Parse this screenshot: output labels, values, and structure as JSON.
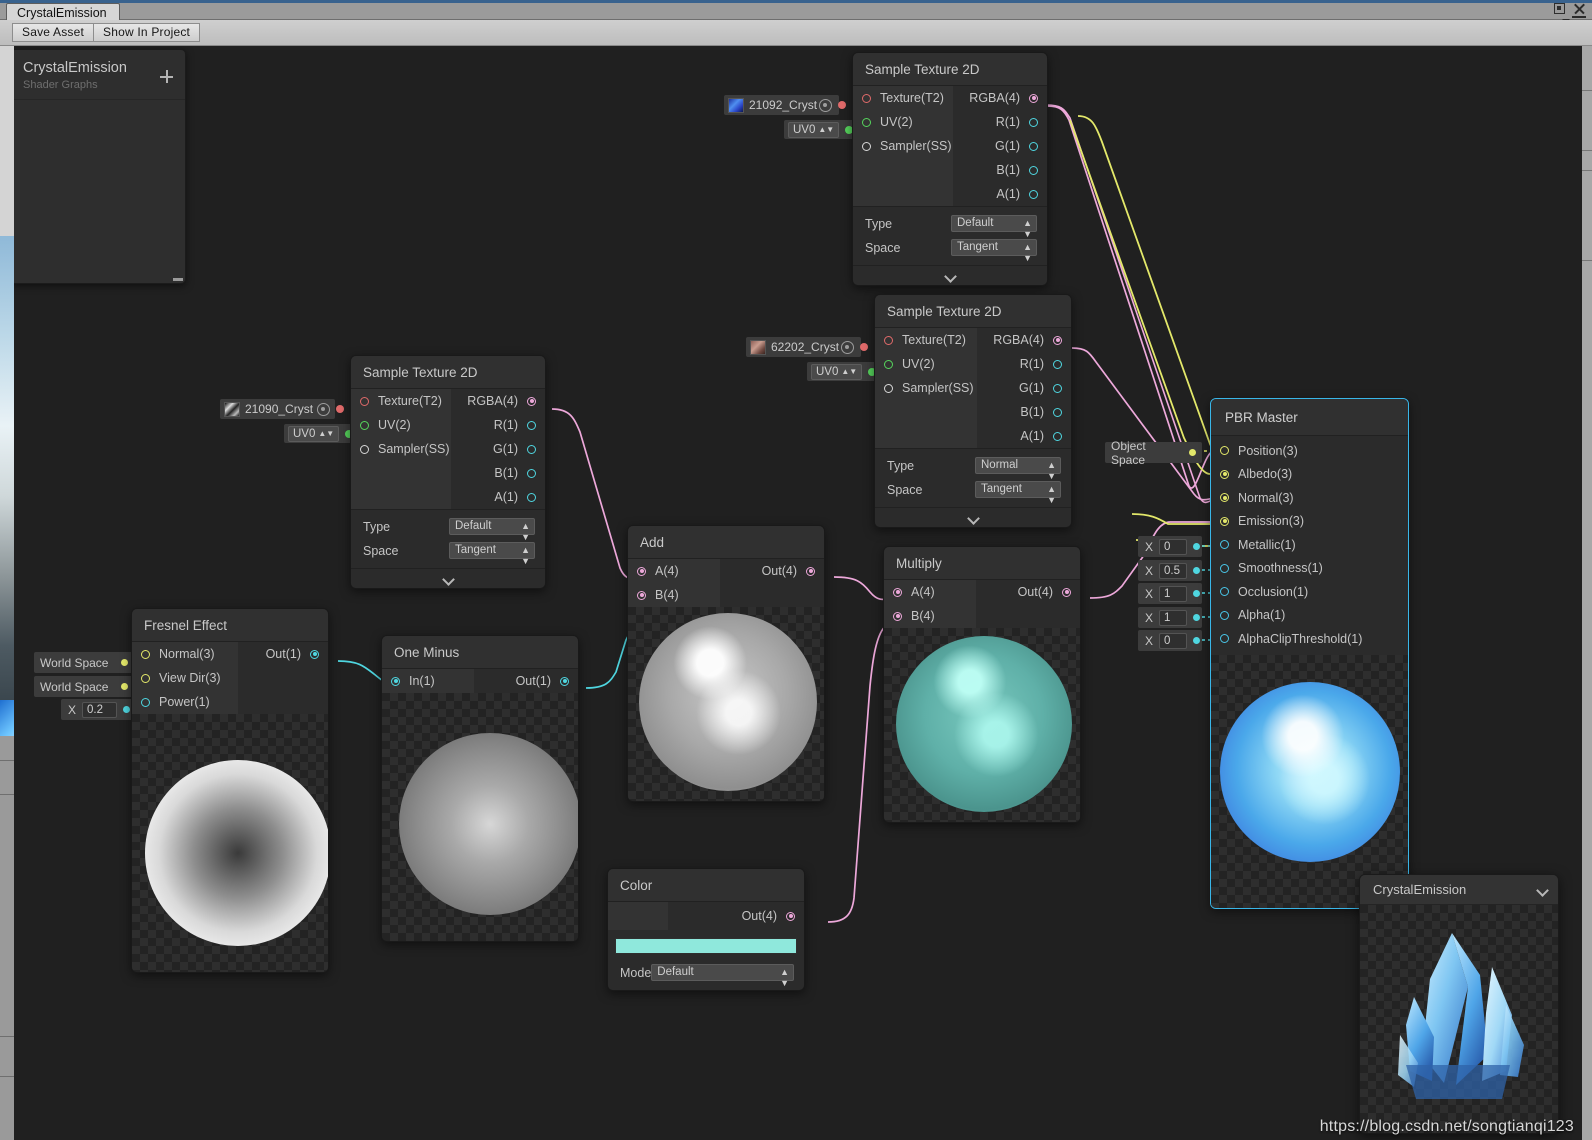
{
  "window": {
    "tab_label": "CrystalEmission",
    "maximize_icon": "maximize-icon",
    "close_icon": "close-icon",
    "menu_icon": "hamburger-menu-icon"
  },
  "toolbar": {
    "save_asset": "Save Asset",
    "show_in_project": "Show In Project"
  },
  "blackboard": {
    "title": "CrystalEmission",
    "subtitle": "Shader Graphs",
    "add_icon": "plus-icon"
  },
  "nodes": {
    "sample_texture_top": {
      "title": "Sample Texture 2D",
      "inputs": [
        "Texture(T2)",
        "UV(2)",
        "Sampler(SS)"
      ],
      "outputs": [
        "RGBA(4)",
        "R(1)",
        "G(1)",
        "B(1)",
        "A(1)"
      ],
      "fields": [
        {
          "label": "Type",
          "value": "Default"
        },
        {
          "label": "Space",
          "value": "Tangent"
        }
      ]
    },
    "sample_texture_mid": {
      "title": "Sample Texture 2D",
      "inputs": [
        "Texture(T2)",
        "UV(2)",
        "Sampler(SS)"
      ],
      "outputs": [
        "RGBA(4)",
        "R(1)",
        "G(1)",
        "B(1)",
        "A(1)"
      ],
      "fields": [
        {
          "label": "Type",
          "value": "Normal"
        },
        {
          "label": "Space",
          "value": "Tangent"
        }
      ]
    },
    "sample_texture_left": {
      "title": "Sample Texture 2D",
      "inputs": [
        "Texture(T2)",
        "UV(2)",
        "Sampler(SS)"
      ],
      "outputs": [
        "RGBA(4)",
        "R(1)",
        "G(1)",
        "B(1)",
        "A(1)"
      ],
      "fields": [
        {
          "label": "Type",
          "value": "Default"
        },
        {
          "label": "Space",
          "value": "Tangent"
        }
      ]
    },
    "fresnel": {
      "title": "Fresnel Effect",
      "inputs": [
        "Normal(3)",
        "View Dir(3)",
        "Power(1)"
      ],
      "outputs": [
        "Out(1)"
      ]
    },
    "one_minus": {
      "title": "One Minus",
      "inputs": [
        "In(1)"
      ],
      "outputs": [
        "Out(1)"
      ]
    },
    "add": {
      "title": "Add",
      "inputs": [
        "A(4)",
        "B(4)"
      ],
      "outputs": [
        "Out(4)"
      ]
    },
    "multiply": {
      "title": "Multiply",
      "inputs": [
        "A(4)",
        "B(4)"
      ],
      "outputs": [
        "Out(4)"
      ]
    },
    "color": {
      "title": "Color",
      "outputs": [
        "Out(4)"
      ],
      "swatch_hex": "#8fe8dc",
      "mode_label": "Mode",
      "mode_value": "Default"
    },
    "pbr_master": {
      "title": "PBR Master",
      "inputs": [
        "Position(3)",
        "Albedo(3)",
        "Normal(3)",
        "Emission(3)",
        "Metallic(1)",
        "Smoothness(1)",
        "Occlusion(1)",
        "Alpha(1)",
        "AlphaClipThreshold(1)"
      ]
    }
  },
  "chips": {
    "texture_top": {
      "name": "21092_Cryst",
      "target_icon": "target-icon"
    },
    "texture_mid": {
      "name": "62202_Cryst",
      "target_icon": "target-icon"
    },
    "texture_left": {
      "name": "21090_Cryst",
      "target_icon": "target-icon"
    },
    "uv_top": "UV0",
    "uv_mid": "UV0",
    "uv_left": "UV0",
    "fresnel_normal_space": "World Space",
    "fresnel_viewdir_space": "World Space",
    "fresnel_power": {
      "axis": "X",
      "value": "0.2"
    },
    "master_position_space": "Object Space",
    "master_metallic": {
      "axis": "X",
      "value": "0"
    },
    "master_smoothness": {
      "axis": "X",
      "value": "0.5"
    },
    "master_occlusion": {
      "axis": "X",
      "value": "1"
    },
    "master_alpha": {
      "axis": "X",
      "value": "1"
    },
    "master_alphaclip": {
      "axis": "X",
      "value": "0"
    }
  },
  "main_preview": {
    "title": "CrystalEmission",
    "collapse_icon": "chevron-down-icon"
  },
  "watermark": "https://blog.csdn.net/songtianqi123",
  "colors": {
    "accent_master_border": "#39b6e8",
    "wire_vec4": "#eda8da",
    "wire_vec3": "#e3e86a",
    "wire_vec1": "#4fd6e0",
    "node_bg": "#2b2b2b",
    "canvas_bg": "#202020"
  }
}
